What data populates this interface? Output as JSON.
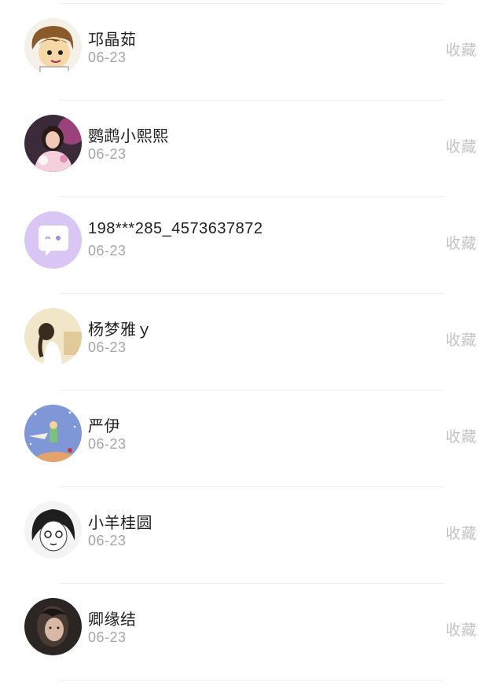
{
  "list": {
    "items": [
      {
        "name": "邛晶茹",
        "date": "06-23",
        "action": "收藏",
        "avatar": "cartoon-boy-avatar"
      },
      {
        "name": "鹦鹉小熙熙",
        "date": "06-23",
        "action": "收藏",
        "avatar": "photo-girl-pink-avatar"
      },
      {
        "name": "198***285_4573637872",
        "date": "06-23",
        "action": "收藏",
        "avatar": "default-chat-bubble-avatar"
      },
      {
        "name": "杨梦雅ｙ",
        "date": "06-23",
        "action": "收藏",
        "avatar": "illustration-girl-braid-avatar"
      },
      {
        "name": "严伊",
        "date": "06-23",
        "action": "收藏",
        "avatar": "little-prince-illustration-avatar"
      },
      {
        "name": "小羊桂圆",
        "date": "06-23",
        "action": "收藏",
        "avatar": "sketch-girl-avatar"
      },
      {
        "name": "卿缘结",
        "date": "06-23",
        "action": "收藏",
        "avatar": "photo-girl-dark-avatar"
      }
    ]
  },
  "colors": {
    "name_text": "#1f1f1f",
    "date_text": "#a6a6a6",
    "action_text": "#c4c4c4",
    "divider": "#f0f0f2",
    "default_avatar_bg": "#d9c6f5"
  }
}
